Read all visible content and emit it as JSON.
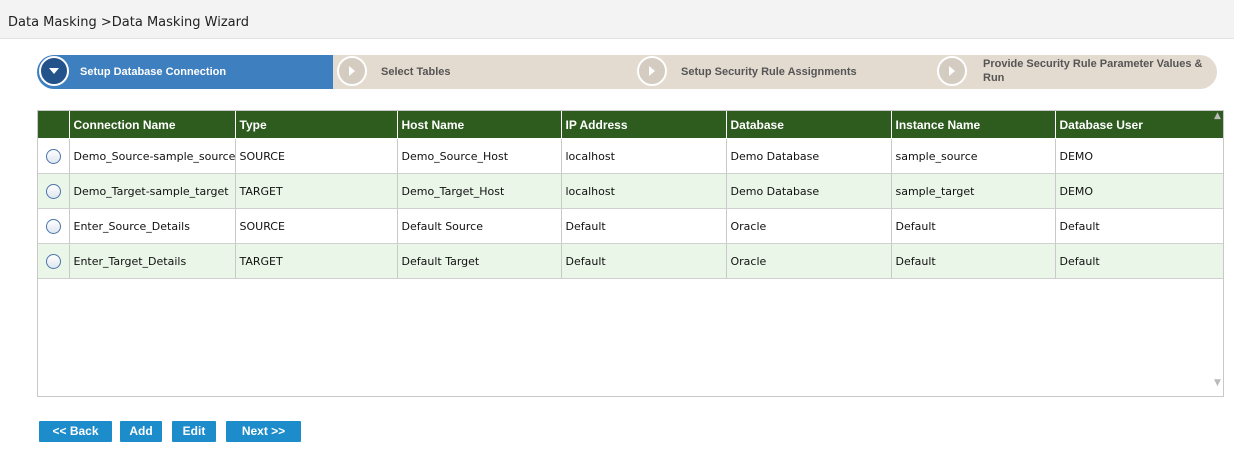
{
  "breadcrumb": "Data Masking >Data Masking Wizard",
  "wizard": {
    "steps": [
      {
        "label": "Setup Database Connection",
        "active": true
      },
      {
        "label": "Select Tables",
        "active": false
      },
      {
        "label": "Setup Security Rule Assignments",
        "active": false
      },
      {
        "label": "Provide Security Rule Parameter Values & Run",
        "active": false
      }
    ]
  },
  "table": {
    "columns": [
      "Connection Name",
      "Type",
      "Host Name",
      "IP Address",
      "Database",
      "Instance Name",
      "Database User"
    ],
    "rows": [
      {
        "connection_name": "Demo_Source-sample_source",
        "type": "SOURCE",
        "host_name": "Demo_Source_Host",
        "ip_address": "localhost",
        "database": "Demo Database",
        "instance_name": "sample_source",
        "database_user": "DEMO"
      },
      {
        "connection_name": "Demo_Target-sample_target",
        "type": "TARGET",
        "host_name": "Demo_Target_Host",
        "ip_address": "localhost",
        "database": "Demo Database",
        "instance_name": "sample_target",
        "database_user": "DEMO"
      },
      {
        "connection_name": "Enter_Source_Details",
        "type": "SOURCE",
        "host_name": "Default Source",
        "ip_address": "Default",
        "database": "Oracle",
        "instance_name": "Default",
        "database_user": "Default"
      },
      {
        "connection_name": "Enter_Target_Details",
        "type": "TARGET",
        "host_name": "Default Target",
        "ip_address": "Default",
        "database": "Oracle",
        "instance_name": "Default",
        "database_user": "Default"
      }
    ]
  },
  "buttons": {
    "back": "<< Back",
    "add": "Add",
    "edit": "Edit",
    "next": "Next >>"
  },
  "colors": {
    "active_step": "#3d7fbf",
    "inactive_step": "#e3dbd0",
    "header_green": "#2e5b1e",
    "alt_row": "#eaf6e8",
    "button_blue": "#1d8ccb"
  }
}
